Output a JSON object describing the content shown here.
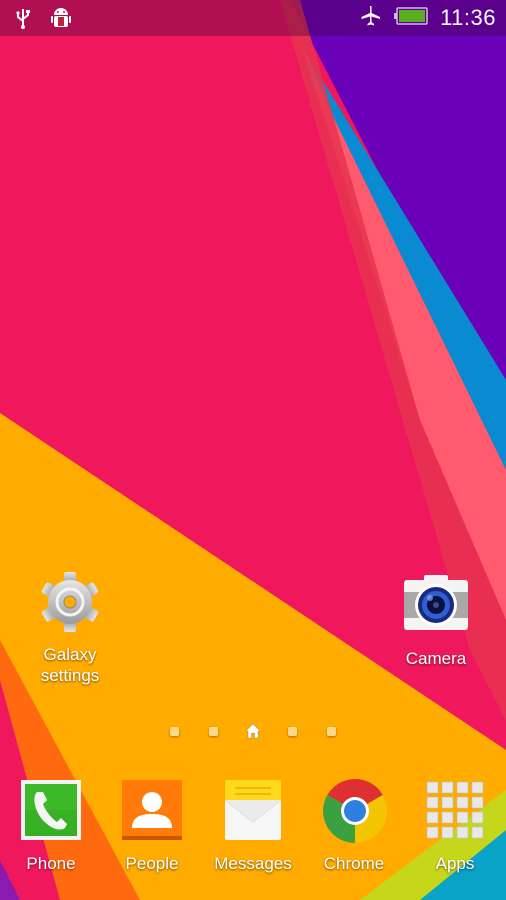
{
  "status_bar": {
    "left_icons": [
      "usb-icon",
      "android-debug-icon"
    ],
    "right_icons": [
      "airplane-mode-icon",
      "battery-icon"
    ],
    "battery_level_percent": 100,
    "time": "11:36"
  },
  "wallpaper": {
    "colors": {
      "pink": "#f0185c",
      "purple": "#6a00b8",
      "blue": "#0a8ad0",
      "salmon": "#ff6868",
      "orange_yellow": "#ffab00",
      "orange": "#ff6a10",
      "yellow_green": "#c6d61a",
      "teal": "#0aa3c8"
    }
  },
  "home_shortcuts": [
    {
      "label_line1": "Galaxy",
      "label_line2": "settings",
      "icon": "settings-gear-icon"
    },
    {
      "label_line1": "Camera",
      "label_line2": "",
      "icon": "camera-icon"
    }
  ],
  "page_indicator": {
    "pages": 5,
    "current": 3,
    "home_page": 3
  },
  "dock": [
    {
      "label": "Phone",
      "icon": "phone-icon"
    },
    {
      "label": "People",
      "icon": "contacts-icon"
    },
    {
      "label": "Messages",
      "icon": "messages-icon"
    },
    {
      "label": "Chrome",
      "icon": "chrome-icon"
    },
    {
      "label": "Apps",
      "icon": "apps-grid-icon"
    }
  ]
}
